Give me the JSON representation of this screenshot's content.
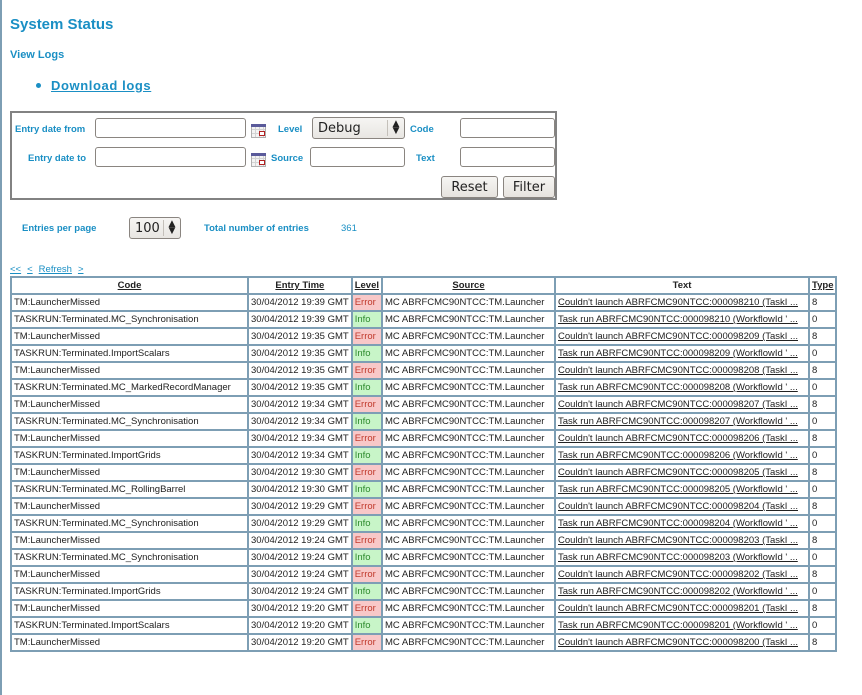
{
  "page": {
    "title": "System Status",
    "subtitle": "View Logs",
    "download_link": "Download logs"
  },
  "filter": {
    "entry_date_from_label": "Entry date from",
    "entry_date_from_value": "",
    "entry_date_to_label": "Entry date to",
    "entry_date_to_value": "",
    "level_label": "Level",
    "level_value": "Debug",
    "source_label": "Source",
    "source_value": "",
    "code_label": "Code",
    "code_value": "",
    "text_label": "Text",
    "text_value": "",
    "reset_label": "Reset",
    "filter_label": "Filter"
  },
  "paging": {
    "entries_per_page_label": "Entries per page",
    "entries_per_page_value": "100",
    "total_label": "Total number of entries",
    "total_value": "361",
    "first": "<<",
    "prev": "<",
    "refresh": "Refresh",
    "next": ">"
  },
  "table": {
    "columns": [
      "Code",
      "Entry Time",
      "Level",
      "Source",
      "Text",
      "Type"
    ],
    "rows": [
      {
        "code": "TM:LauncherMissed",
        "time": "30/04/2012  19:39 GMT",
        "level": "Error",
        "source": "MC ABRFCMC90NTCC:TM.Launcher",
        "text": "Couldn't launch ABRFCMC90NTCC:000098210 (TaskI ...",
        "type": "8"
      },
      {
        "code": "TASKRUN:Terminated.MC_Synchronisation",
        "time": "30/04/2012  19:39 GMT",
        "level": "Info",
        "source": "MC ABRFCMC90NTCC:TM.Launcher",
        "text": "Task run ABRFCMC90NTCC:000098210 (WorkflowId ' ...",
        "type": "0"
      },
      {
        "code": "TM:LauncherMissed",
        "time": "30/04/2012  19:35 GMT",
        "level": "Error",
        "source": "MC ABRFCMC90NTCC:TM.Launcher",
        "text": "Couldn't launch ABRFCMC90NTCC:000098209 (TaskI ...",
        "type": "8"
      },
      {
        "code": "TASKRUN:Terminated.ImportScalars",
        "time": "30/04/2012  19:35 GMT",
        "level": "Info",
        "source": "MC ABRFCMC90NTCC:TM.Launcher",
        "text": "Task run ABRFCMC90NTCC:000098209 (WorkflowId ' ...",
        "type": "0"
      },
      {
        "code": "TM:LauncherMissed",
        "time": "30/04/2012  19:35 GMT",
        "level": "Error",
        "source": "MC ABRFCMC90NTCC:TM.Launcher",
        "text": "Couldn't launch ABRFCMC90NTCC:000098208 (TaskI ...",
        "type": "8"
      },
      {
        "code": "TASKRUN:Terminated.MC_MarkedRecordManager",
        "time": "30/04/2012  19:35 GMT",
        "level": "Info",
        "source": "MC ABRFCMC90NTCC:TM.Launcher",
        "text": "Task run ABRFCMC90NTCC:000098208 (WorkflowId ' ...",
        "type": "0"
      },
      {
        "code": "TM:LauncherMissed",
        "time": "30/04/2012  19:34 GMT",
        "level": "Error",
        "source": "MC ABRFCMC90NTCC:TM.Launcher",
        "text": "Couldn't launch ABRFCMC90NTCC:000098207 (TaskI ...",
        "type": "8"
      },
      {
        "code": "TASKRUN:Terminated.MC_Synchronisation",
        "time": "30/04/2012  19:34 GMT",
        "level": "Info",
        "source": "MC ABRFCMC90NTCC:TM.Launcher",
        "text": "Task run ABRFCMC90NTCC:000098207 (WorkflowId ' ...",
        "type": "0"
      },
      {
        "code": "TM:LauncherMissed",
        "time": "30/04/2012  19:34 GMT",
        "level": "Error",
        "source": "MC ABRFCMC90NTCC:TM.Launcher",
        "text": "Couldn't launch ABRFCMC90NTCC:000098206 (TaskI ...",
        "type": "8"
      },
      {
        "code": "TASKRUN:Terminated.ImportGrids",
        "time": "30/04/2012  19:34 GMT",
        "level": "Info",
        "source": "MC ABRFCMC90NTCC:TM.Launcher",
        "text": "Task run ABRFCMC90NTCC:000098206 (WorkflowId ' ...",
        "type": "0"
      },
      {
        "code": "TM:LauncherMissed",
        "time": "30/04/2012  19:30 GMT",
        "level": "Error",
        "source": "MC ABRFCMC90NTCC:TM.Launcher",
        "text": "Couldn't launch ABRFCMC90NTCC:000098205 (TaskI ...",
        "type": "8"
      },
      {
        "code": "TASKRUN:Terminated.MC_RollingBarrel",
        "time": "30/04/2012  19:30 GMT",
        "level": "Info",
        "source": "MC ABRFCMC90NTCC:TM.Launcher",
        "text": "Task run ABRFCMC90NTCC:000098205 (WorkflowId ' ...",
        "type": "0"
      },
      {
        "code": "TM:LauncherMissed",
        "time": "30/04/2012  19:29 GMT",
        "level": "Error",
        "source": "MC ABRFCMC90NTCC:TM.Launcher",
        "text": "Couldn't launch ABRFCMC90NTCC:000098204 (TaskI ...",
        "type": "8"
      },
      {
        "code": "TASKRUN:Terminated.MC_Synchronisation",
        "time": "30/04/2012  19:29 GMT",
        "level": "Info",
        "source": "MC ABRFCMC90NTCC:TM.Launcher",
        "text": "Task run ABRFCMC90NTCC:000098204 (WorkflowId ' ...",
        "type": "0"
      },
      {
        "code": "TM:LauncherMissed",
        "time": "30/04/2012  19:24 GMT",
        "level": "Error",
        "source": "MC ABRFCMC90NTCC:TM.Launcher",
        "text": "Couldn't launch ABRFCMC90NTCC:000098203 (TaskI ...",
        "type": "8"
      },
      {
        "code": "TASKRUN:Terminated.MC_Synchronisation",
        "time": "30/04/2012  19:24 GMT",
        "level": "Info",
        "source": "MC ABRFCMC90NTCC:TM.Launcher",
        "text": "Task run ABRFCMC90NTCC:000098203 (WorkflowId ' ...",
        "type": "0"
      },
      {
        "code": "TM:LauncherMissed",
        "time": "30/04/2012  19:24 GMT",
        "level": "Error",
        "source": "MC ABRFCMC90NTCC:TM.Launcher",
        "text": "Couldn't launch ABRFCMC90NTCC:000098202 (TaskI ...",
        "type": "8"
      },
      {
        "code": "TASKRUN:Terminated.ImportGrids",
        "time": "30/04/2012  19:24 GMT",
        "level": "Info",
        "source": "MC ABRFCMC90NTCC:TM.Launcher",
        "text": "Task run ABRFCMC90NTCC:000098202 (WorkflowId ' ...",
        "type": "0"
      },
      {
        "code": "TM:LauncherMissed",
        "time": "30/04/2012  19:20 GMT",
        "level": "Error",
        "source": "MC ABRFCMC90NTCC:TM.Launcher",
        "text": "Couldn't launch ABRFCMC90NTCC:000098201 (TaskI ...",
        "type": "8"
      },
      {
        "code": "TASKRUN:Terminated.ImportScalars",
        "time": "30/04/2012  19:20 GMT",
        "level": "Info",
        "source": "MC ABRFCMC90NTCC:TM.Launcher",
        "text": "Task run ABRFCMC90NTCC:000098201 (WorkflowId ' ...",
        "type": "0"
      },
      {
        "code": "TM:LauncherMissed",
        "time": "30/04/2012  19:20 GMT",
        "level": "Error",
        "source": "MC ABRFCMC90NTCC:TM.Launcher",
        "text": "Couldn't launch ABRFCMC90NTCC:000098200 (TaskI ...",
        "type": "8"
      }
    ]
  }
}
